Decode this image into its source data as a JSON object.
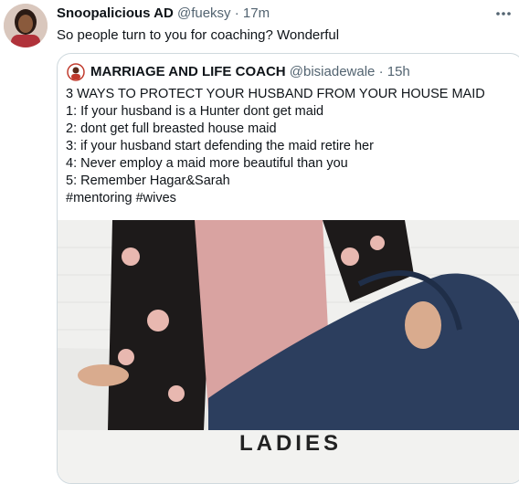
{
  "tweet": {
    "author_name": "Snoopalicious AD",
    "author_handle": "@fueksy",
    "separator": "·",
    "time": "17m",
    "text": "So people turn to you for coaching? Wonderful",
    "more_icon": "more-icon"
  },
  "quote": {
    "author_name": "MARRIAGE AND LIFE COACH",
    "author_handle": "@bisiadewale",
    "separator": "·",
    "time": "15h",
    "lines": [
      "3 WAYS TO PROTECT YOUR HUSBAND FROM YOUR HOUSE MAID",
      "1: If your husband is a Hunter dont get maid",
      "2: dont get full breasted house maid",
      "3: if your husband start defending the maid retire her",
      "4: Never employ a maid more beautiful than you",
      "5: Remember Hagar&Sarah",
      "#mentoring #wives"
    ],
    "image_caption": "LADIES"
  },
  "colors": {
    "text": "#0f1419",
    "secondary": "#536471",
    "border": "#cfd9de"
  }
}
